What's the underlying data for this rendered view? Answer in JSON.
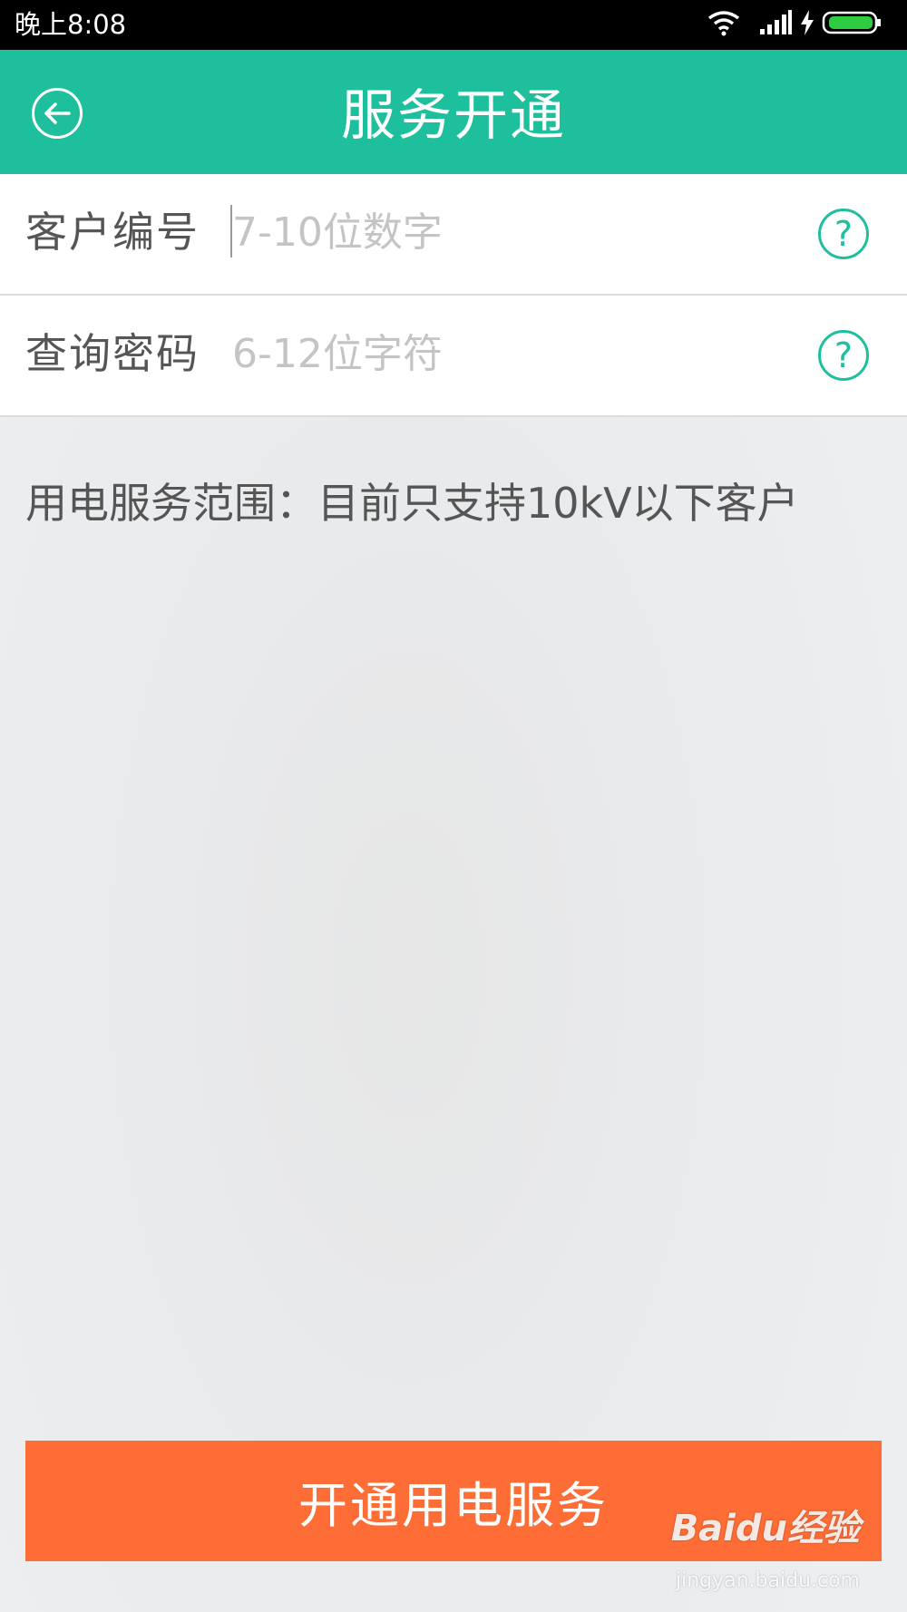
{
  "status_bar": {
    "time": "晚上8:08",
    "icons": [
      "wifi-icon",
      "signal-icon",
      "charging-icon",
      "battery-icon"
    ],
    "battery_color": "#2ecc40"
  },
  "header": {
    "title": "服务开通",
    "back_icon": "back-arrow-icon",
    "background": "#1dbf9c"
  },
  "form": {
    "customer_number": {
      "label": "客户编号",
      "placeholder": "7-10位数字",
      "value": "",
      "help_icon": "?"
    },
    "query_password": {
      "label": "查询密码",
      "placeholder": "6-12位字符",
      "value": "",
      "help_icon": "?"
    }
  },
  "notice": "用电服务范围：目前只支持10kV以下客户",
  "submit_button": {
    "label": "开通用电服务",
    "color": "#fe6d35"
  },
  "watermark": {
    "logo_text": "Baidu经验",
    "url": "jingyan.baidu.com"
  }
}
